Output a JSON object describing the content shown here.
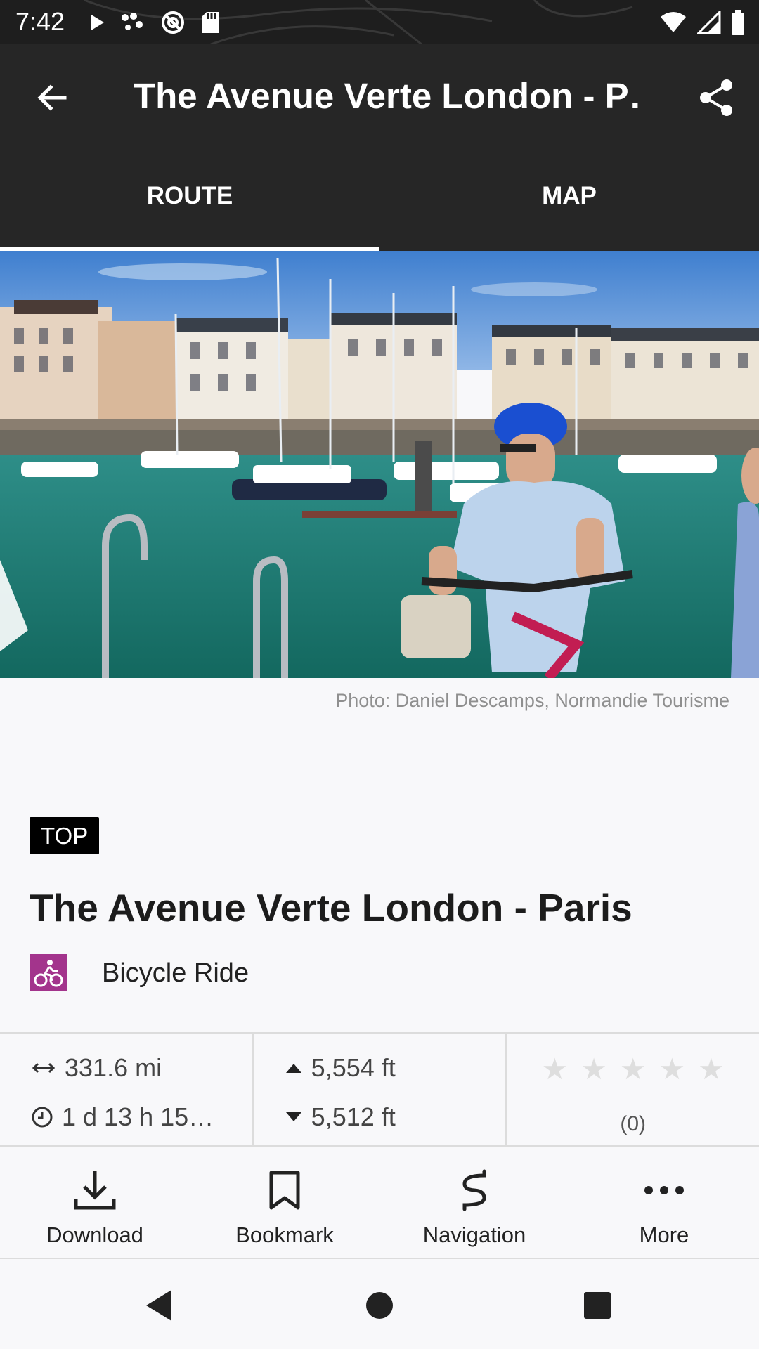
{
  "status_bar": {
    "time": "7:42"
  },
  "app_bar": {
    "title": "The Avenue Verte London - P…"
  },
  "tabs": [
    {
      "label": "ROUTE",
      "active": true
    },
    {
      "label": "MAP",
      "active": false
    }
  ],
  "hero": {
    "credit": "Photo: Daniel Descamps, Normandie Tourisme"
  },
  "route": {
    "badge": "TOP",
    "title": "The Avenue Verte London - Paris",
    "activity": "Bicycle Ride",
    "activity_color": "#a3348c"
  },
  "stats": {
    "distance": "331.6 mi",
    "duration": "1 d 13 h 15…",
    "ascent": "5,554 ft",
    "descent": "5,512 ft",
    "rating_stars": 0,
    "rating_max": 5,
    "rating_count": "(0)"
  },
  "actions": [
    {
      "label": "Download",
      "icon": "download-icon"
    },
    {
      "label": "Bookmark",
      "icon": "bookmark-icon"
    },
    {
      "label": "Navigation",
      "icon": "navigation-icon"
    },
    {
      "label": "More",
      "icon": "more-icon"
    }
  ]
}
